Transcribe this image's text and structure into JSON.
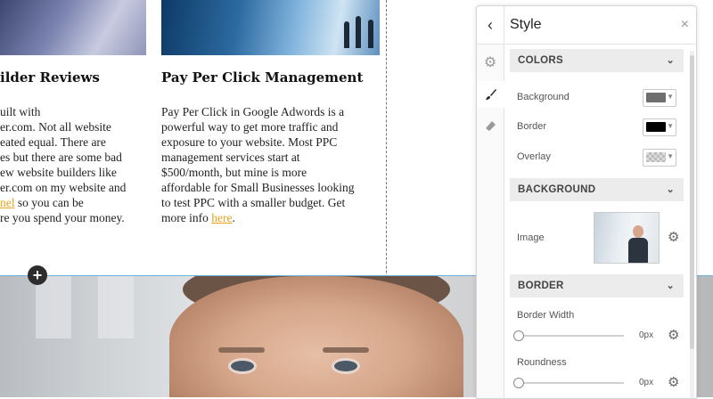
{
  "page": {
    "col_left": {
      "heading": "ilder Reviews",
      "lines": [
        "uilt with",
        "er.com. Not all website",
        "eated equal. There are",
        "es but there are some bad",
        "ew website builders like",
        "er.com on my website and"
      ],
      "line7_link": "nel",
      "line7_rest": " so you can be",
      "line8": "re you spend your money."
    },
    "col_right": {
      "heading": "Pay Per Click Management",
      "lines": [
        "Pay Per Click in Google Adwords is a",
        "powerful way to get more traffic and",
        "exposure to your website.  Most PPC",
        "management services start at",
        "$500/month, but mine is more",
        "affordable for Small Businesses looking",
        "to test PPC with a smaller budget. Get"
      ],
      "line8_pre": "more info ",
      "line8_link": "here",
      "line8_post": "."
    },
    "add_button": "+"
  },
  "style_panel": {
    "title": "Style",
    "back_icon": "‹",
    "close_icon": "×",
    "rail": {
      "settings_icon": "⚙",
      "brush_icon": "🖌",
      "eraser_icon": "▰"
    },
    "colors": {
      "header": "COLORS",
      "background_label": "Background",
      "background_color": "#6e6e6e",
      "border_label": "Border",
      "border_color": "#000000",
      "overlay_label": "Overlay",
      "overlay_color": "transparent"
    },
    "background": {
      "header": "BACKGROUND",
      "image_label": "Image"
    },
    "border": {
      "header": "BORDER",
      "width_label": "Border Width",
      "width_value": "0px",
      "roundness_label": "Roundness",
      "roundness_value": "0px"
    },
    "chevron": "⌄"
  }
}
